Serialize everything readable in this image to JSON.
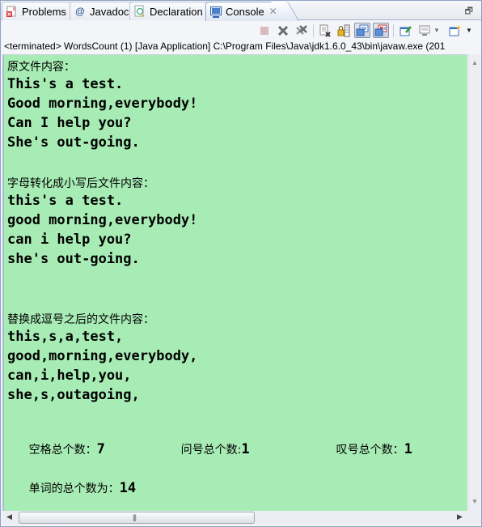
{
  "tabs": [
    {
      "label": "Problems",
      "icon": "problems-icon",
      "active": false
    },
    {
      "label": "Javadoc",
      "icon": "at-icon",
      "active": false
    },
    {
      "label": "Declaration",
      "icon": "declaration-icon",
      "active": false
    },
    {
      "label": "Console",
      "icon": "console-icon",
      "active": true
    }
  ],
  "toolbar": {
    "buttons": [
      {
        "name": "terminate-icon"
      },
      {
        "name": "remove-launch-icon"
      },
      {
        "name": "remove-all-terminated-icon"
      },
      {
        "name": "clear-console-icon"
      },
      {
        "name": "scroll-lock-icon"
      },
      {
        "name": "show-console-on-stdout-icon",
        "pressed": true
      },
      {
        "name": "show-console-on-stderr-icon",
        "pressed": true
      },
      {
        "name": "pin-console-icon"
      },
      {
        "name": "display-selected-console-icon"
      },
      {
        "name": "open-console-icon"
      }
    ]
  },
  "status": "<terminated> WordsCount (1) [Java Application] C:\\Program Files\\Java\\jdk1.6.0_43\\bin\\javaw.exe (201",
  "console": {
    "original_header": "原文件内容：",
    "original_lines": [
      "This's a test.",
      "Good morning,everybody!",
      "Can I help you?",
      "She's out-going."
    ],
    "lower_header": "字母转化成小写后文件内容：",
    "lower_lines": [
      "this's a test.",
      "good morning,everybody!",
      "can i help you?",
      "she's out-going."
    ],
    "comma_header": "替换成逗号之后的文件内容：",
    "comma_lines": [
      "this,s,a,test,",
      "good,morning,everybody,",
      "can,i,help,you,",
      "she,s,outagoing,"
    ],
    "stats": {
      "space_label": "空格总个数：",
      "space_value": "7",
      "question_label": "问号总个数:",
      "question_value": "1",
      "exclaim_label": "叹号总个数：",
      "exclaim_value": "1"
    },
    "words_label": "单词的总个数为：",
    "words_value": "14"
  },
  "colors": {
    "console_bg": "#a8ecb5"
  }
}
